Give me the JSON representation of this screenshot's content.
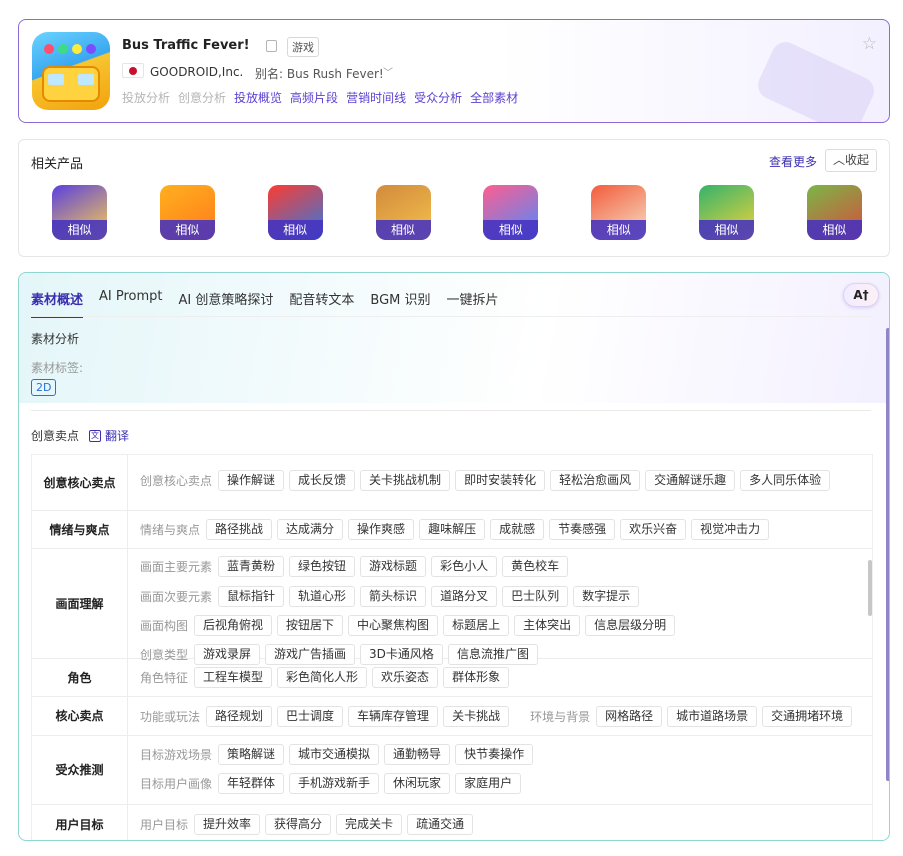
{
  "app": {
    "title": "Bus Traffic Fever!",
    "genre": "游戏",
    "developer": "GOODROID,Inc.",
    "alias": "别名: Bus Rush Fever!",
    "nav": [
      {
        "label": "投放分析",
        "state": "disabled"
      },
      {
        "label": "创意分析",
        "state": "disabled"
      },
      {
        "label": "投放概览",
        "state": "active"
      },
      {
        "label": "高频片段",
        "state": "active"
      },
      {
        "label": "营销时间线",
        "state": "active"
      },
      {
        "label": "受众分析",
        "state": "active"
      },
      {
        "label": "全部素材",
        "state": "active"
      }
    ]
  },
  "related": {
    "title": "相关产品",
    "view_more": "查看更多",
    "collapse": "收起",
    "items": [
      {
        "badge": "相似",
        "color_a": "#5a3fe0",
        "color_b": "#ffd24a"
      },
      {
        "badge": "相似",
        "color_a": "#ffb01f",
        "color_b": "#ff7a1a"
      },
      {
        "badge": "相似",
        "color_a": "#ff3b30",
        "color_b": "#2a7be4"
      },
      {
        "badge": "相似",
        "color_a": "#d28a3c",
        "color_b": "#f4c24d"
      },
      {
        "badge": "相似",
        "color_a": "#ff5d8f",
        "color_b": "#4a8cff"
      },
      {
        "badge": "相似",
        "color_a": "#f25c3c",
        "color_b": "#f7e2c8"
      },
      {
        "badge": "相似",
        "color_a": "#33b36b",
        "color_b": "#f5d33a"
      },
      {
        "badge": "相似",
        "color_a": "#7ab648",
        "color_b": "#d94b3c"
      }
    ]
  },
  "tabs": [
    "素材概述",
    "AI Prompt",
    "AI 创意策略探讨",
    "配音转文本",
    "BGM 识别",
    "一键拆片"
  ],
  "ai_button": "A†",
  "analysis": {
    "title": "素材分析",
    "tags_label": "素材标签:",
    "tag": "2D",
    "selling_title": "创意卖点",
    "translate": "翻译"
  },
  "table": [
    {
      "head": "创意核心卖点",
      "lines": [
        {
          "label": "创意核心卖点",
          "chips": [
            "操作解谜",
            "成长反馈",
            "关卡挑战机制",
            "即时安装转化",
            "轻松治愈画风",
            "交通解谜乐趣",
            "多人同乐体验"
          ]
        }
      ]
    },
    {
      "head": "情绪与爽点",
      "lines": [
        {
          "label": "情绪与爽点",
          "chips": [
            "路径挑战",
            "达成满分",
            "操作爽感",
            "趣味解压",
            "成就感",
            "节奏感强",
            "欢乐兴奋",
            "视觉冲击力"
          ]
        }
      ]
    },
    {
      "head": "画面理解",
      "lines": [
        {
          "label": "画面主要元素",
          "chips": [
            "蓝青黄粉",
            "绿色按钮",
            "游戏标题",
            "彩色小人",
            "黄色校车"
          ]
        },
        {
          "label": "画面次要元素",
          "chips": [
            "鼠标指针",
            "轨道心形",
            "箭头标识",
            "道路分叉",
            "巴士队列",
            "数字提示"
          ]
        },
        {
          "label": "画面构图",
          "chips": [
            "后视角俯视",
            "按钮居下",
            "中心聚焦构图",
            "标题居上",
            "主体突出",
            "信息层级分明"
          ]
        },
        {
          "label": "创意类型",
          "chips": [
            "游戏录屏",
            "游戏广告插画",
            "3D卡通风格",
            "信息流推广图"
          ]
        }
      ]
    },
    {
      "head": "角色",
      "lines": [
        {
          "label": "角色特征",
          "chips": [
            "工程车模型",
            "彩色简化人形",
            "欢乐姿态",
            "群体形象"
          ]
        }
      ]
    },
    {
      "head": "核心卖点",
      "lines": [
        {
          "label": "功能或玩法",
          "chips": [
            "路径规划",
            "巴士调度",
            "车辆库存管理",
            "关卡挑战"
          ],
          "label2": "环境与背景",
          "chips2": [
            "网格路径",
            "城市道路场景",
            "交通拥堵环境"
          ]
        }
      ]
    },
    {
      "head": "受众推测",
      "lines": [
        {
          "label": "目标游戏场景",
          "chips": [
            "策略解谜",
            "城市交通模拟",
            "通勤畅导",
            "快节奏操作"
          ]
        },
        {
          "label": "目标用户画像",
          "chips": [
            "年轻群体",
            "手机游戏新手",
            "休闲玩家",
            "家庭用户"
          ]
        }
      ]
    },
    {
      "head": "用户目标",
      "lines": [
        {
          "label": "用户目标",
          "chips": [
            "提升效率",
            "获得高分",
            "完成关卡",
            "疏通交通"
          ]
        }
      ]
    }
  ]
}
